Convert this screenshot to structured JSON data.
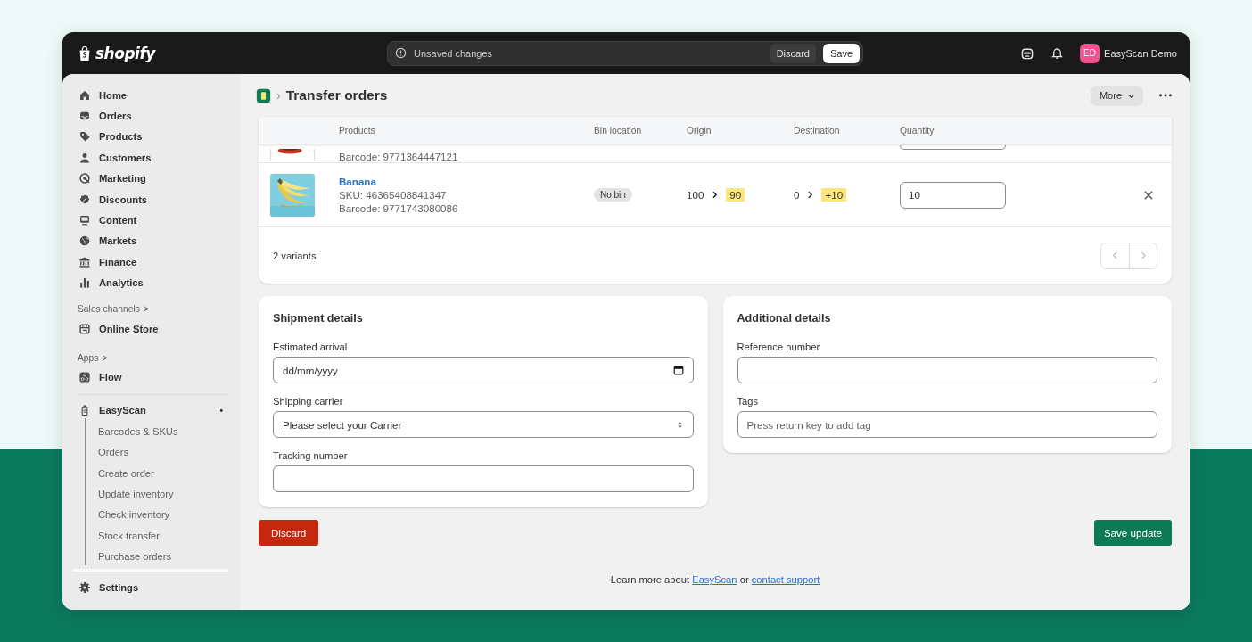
{
  "topbar": {
    "brand": "shopify",
    "save_bar": {
      "message": "Unsaved changes",
      "discard": "Discard",
      "save": "Save"
    },
    "user": {
      "initials": "ED",
      "name": "EasyScan Demo",
      "color": "#f2528f"
    }
  },
  "sidebar": {
    "items": [
      {
        "label": "Home",
        "selected": false
      },
      {
        "label": "Orders",
        "selected": false
      },
      {
        "label": "Products",
        "selected": false
      },
      {
        "label": "Customers",
        "selected": false
      },
      {
        "label": "Marketing",
        "selected": false
      },
      {
        "label": "Discounts",
        "selected": false
      },
      {
        "label": "Content",
        "selected": false
      },
      {
        "label": "Markets",
        "selected": false
      },
      {
        "label": "Finance",
        "selected": false
      },
      {
        "label": "Analytics",
        "selected": false
      }
    ],
    "sales_channels": {
      "heading": "Sales channels",
      "chevron": ">",
      "items": [
        {
          "label": "Online Store"
        }
      ]
    },
    "apps": {
      "heading": "Apps",
      "chevron": ">",
      "items": [
        {
          "label": "Flow"
        }
      ]
    },
    "app": {
      "name": "EasyScan",
      "dot": "•",
      "children": [
        {
          "label": "Barcodes & SKUs"
        },
        {
          "label": "Orders"
        },
        {
          "label": "Create order"
        },
        {
          "label": "Update inventory"
        },
        {
          "label": "Check inventory"
        },
        {
          "label": "Stock transfer"
        },
        {
          "label": "Purchase orders"
        }
      ]
    },
    "settings": "Settings"
  },
  "page": {
    "breadcrumb_sep": "›",
    "title": "Transfer orders",
    "more": "More"
  },
  "table": {
    "columns": [
      "Products",
      "Bin location",
      "Origin",
      "Destination",
      "Quantity"
    ],
    "partial_row": {
      "barcode": "Barcode: 9771364447121"
    },
    "rows": [
      {
        "name": "Banana",
        "sku": "SKU: 46365408841347",
        "barcode": "Barcode: 9771743080086",
        "bin": "No bin",
        "origin_from": "100",
        "origin_to": "90",
        "dest_from": "0",
        "dest_to": "+10",
        "quantity": "10"
      }
    ],
    "footer": "2 variants"
  },
  "shipment": {
    "title": "Shipment details",
    "fields": [
      {
        "kind": "date",
        "label": "Estimated arrival",
        "placeholder": "dd/mm/yyyy"
      },
      {
        "kind": "select",
        "label": "Shipping carrier",
        "value": "Please select your Carrier"
      },
      {
        "kind": "text",
        "label": "Tracking number"
      }
    ]
  },
  "additional": {
    "title": "Additional details",
    "fields": [
      {
        "kind": "text",
        "label": "Reference number"
      },
      {
        "kind": "text",
        "label": "Tags",
        "placeholder": "Press return key to add tag"
      }
    ]
  },
  "actions": {
    "discard": "Discard",
    "save": "Save update"
  },
  "footer": {
    "before": "Learn more about ",
    "link": "EasyScan",
    "middle": " or ",
    "link2": "contact support"
  }
}
